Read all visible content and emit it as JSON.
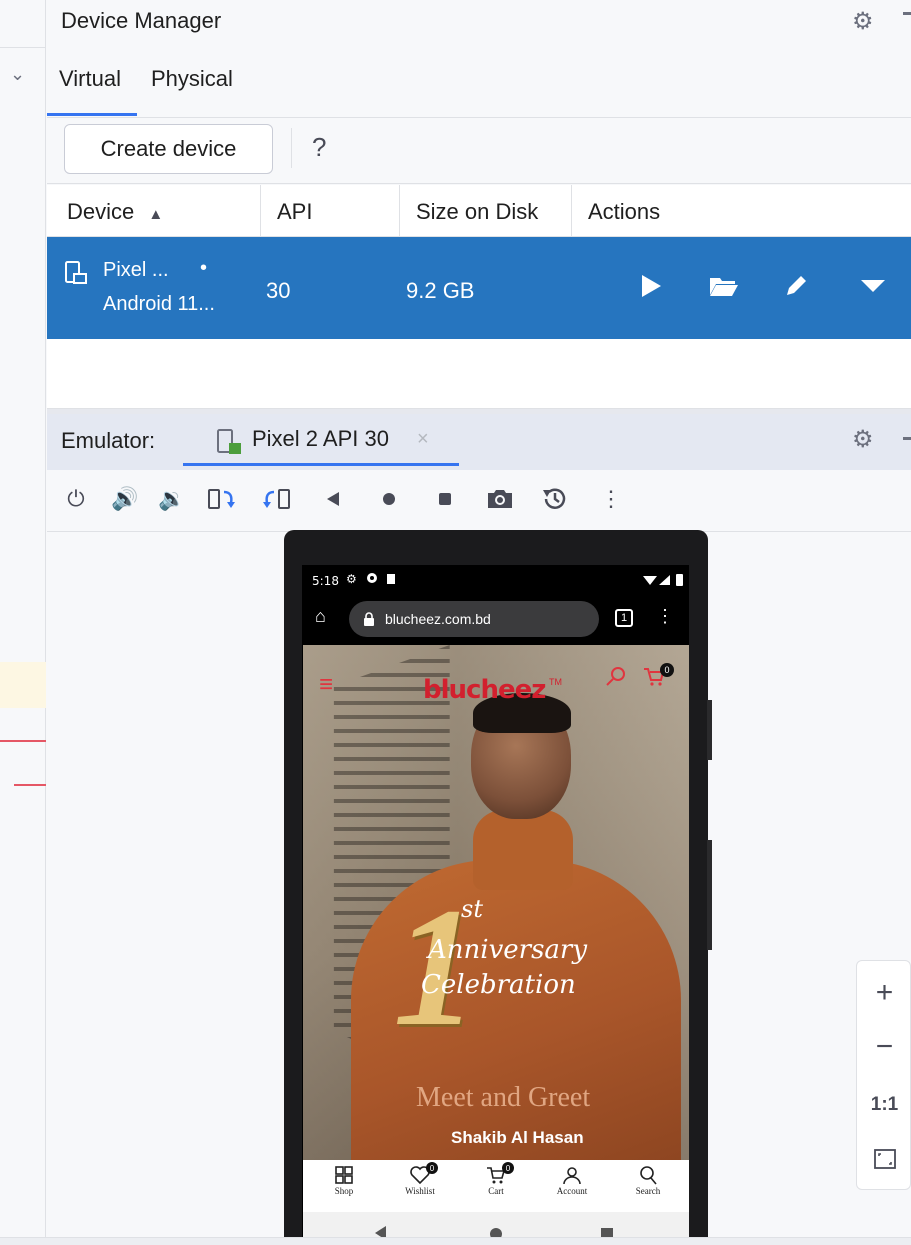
{
  "device_manager": {
    "title": "Device Manager",
    "tabs": [
      {
        "label": "Virtual",
        "active": true
      },
      {
        "label": "Physical",
        "active": false
      }
    ],
    "create_button": "Create device",
    "help_label": "?",
    "columns": {
      "device": "Device",
      "sort_indicator": "▲",
      "api": "API",
      "size": "Size on Disk",
      "actions": "Actions"
    },
    "rows": [
      {
        "name": "Pixel ...",
        "running_dot": "•",
        "subtitle": "Android 11...",
        "api": "30",
        "size": "9.2 GB",
        "selected": true
      }
    ]
  },
  "emulator": {
    "label": "Emulator:",
    "tab_label": "Pixel 2 API 30",
    "close_glyph": "×"
  },
  "phone": {
    "status_time": "5:18",
    "url": "blucheez.com.bd",
    "tab_count": "1",
    "site": {
      "logo": "blucheez",
      "logo_tm": "TM",
      "cart_count": "0",
      "banner_number": "1",
      "banner_ordinal": "st",
      "banner_line1": "Anniversary",
      "banner_line2": "Celebration",
      "banner_subtitle": "Meet and Greet",
      "banner_name": "Shakib Al Hasan"
    },
    "bottom_nav": [
      {
        "label": "Shop",
        "icon": "grid-icon",
        "badge": ""
      },
      {
        "label": "Wishlist",
        "icon": "heart-icon",
        "badge": "0"
      },
      {
        "label": "Cart",
        "icon": "cart-icon",
        "badge": "0"
      },
      {
        "label": "Account",
        "icon": "person-icon",
        "badge": ""
      },
      {
        "label": "Search",
        "icon": "search-icon",
        "badge": ""
      }
    ]
  },
  "zoom": {
    "plus": "+",
    "minus": "−",
    "one_to_one": "1:1"
  },
  "colors": {
    "accent": "#3574f0",
    "selection": "#2675bf",
    "brand_red": "#d2202e"
  }
}
